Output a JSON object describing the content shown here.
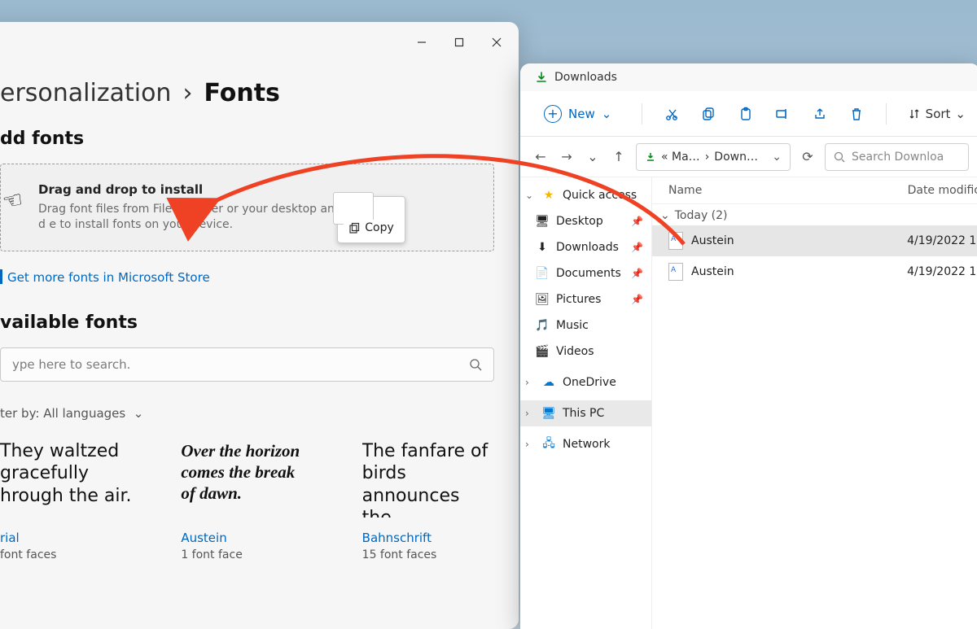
{
  "settings": {
    "breadcrumb_parent": "ersonalization",
    "breadcrumb_sep": "›",
    "breadcrumb_current": "Fonts",
    "add_heading": "dd fonts",
    "drop_title": "Drag and drop to install",
    "drop_desc": "Drag font files from File Explorer or your desktop and d               e to install fonts on your device.",
    "store_link": "Get more fonts in Microsoft Store",
    "available_heading": "vailable fonts",
    "search_placeholder": "ype here to search.",
    "filter_label": "ter by:",
    "filter_value": "All languages",
    "cards": [
      {
        "sample": "They waltzed gracefully hrough the air.",
        "name": "rial",
        "faces": "font faces",
        "style": ""
      },
      {
        "sample": "Over the horizon comes the break of dawn.",
        "name": "Austein",
        "faces": "1 font face",
        "style": "script"
      },
      {
        "sample": "The fanfare of birds announces the…",
        "name": "Bahnschrift",
        "faces": "15 font faces",
        "style": ""
      }
    ],
    "copy_label": "Copy"
  },
  "explorer": {
    "tab_title": "Downloads",
    "new_label": "New",
    "sort_label": "Sort",
    "breadcrumb_prefix": "« Ma…",
    "breadcrumb_current": "Down…",
    "search_placeholder": "Search Downloa",
    "col_name": "Name",
    "col_date": "Date modific",
    "group_label": "Today (2)",
    "files": [
      {
        "name": "Austein",
        "date": "4/19/2022 1:",
        "selected": true
      },
      {
        "name": "Austein",
        "date": "4/19/2022 1:",
        "selected": false
      }
    ],
    "sidebar": {
      "quick": "Quick access",
      "items": [
        {
          "label": "Desktop",
          "icon": "desktop",
          "pin": true
        },
        {
          "label": "Downloads",
          "icon": "download",
          "pin": true
        },
        {
          "label": "Documents",
          "icon": "document",
          "pin": true
        },
        {
          "label": "Pictures",
          "icon": "picture",
          "pin": true
        },
        {
          "label": "Music",
          "icon": "music",
          "pin": false
        },
        {
          "label": "Videos",
          "icon": "video",
          "pin": false
        }
      ],
      "onedrive": "OneDrive",
      "thispc": "This PC",
      "network": "Network"
    }
  }
}
